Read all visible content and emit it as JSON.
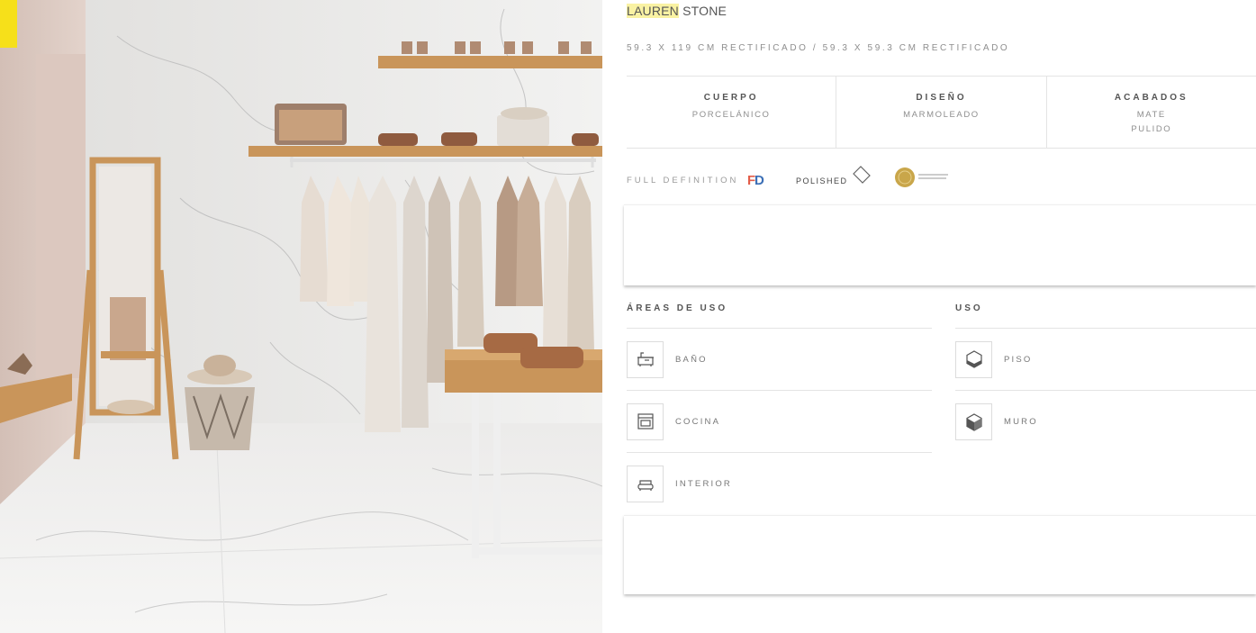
{
  "product": {
    "title_highlight": "LAUREN",
    "title_rest": " STONE",
    "formats": "59.3 X 119 CM RECTIFICADO / 59.3 X 59.3 CM RECTIFICADO"
  },
  "specs": [
    {
      "head": "CUERPO",
      "values": [
        "PORCELÁNICO"
      ]
    },
    {
      "head": "DISEÑO",
      "values": [
        "MARMOLEADO"
      ]
    },
    {
      "head": "ACABADOS",
      "values": [
        "MATE",
        "PULIDO"
      ]
    }
  ],
  "badges": {
    "full_definition": "FULL DEFINITION",
    "fd_mark": "FD",
    "polished": "POLISHED"
  },
  "areas": {
    "heading": "ÁREAS DE USO",
    "items": [
      {
        "label": "BAÑO",
        "icon": "bathtub-icon"
      },
      {
        "label": "COCINA",
        "icon": "oven-icon"
      },
      {
        "label": "INTERIOR",
        "icon": "sofa-icon"
      }
    ]
  },
  "uso": {
    "heading": "USO",
    "items": [
      {
        "label": "PISO",
        "icon": "floor-cube-icon"
      },
      {
        "label": "MURO",
        "icon": "wall-cube-icon"
      }
    ]
  },
  "colors": {
    "accent_yellow": "#f6e01a",
    "title_highlight": "#f9f2a3",
    "wood": "#c9955a",
    "gold_seal": "#c9a64a"
  }
}
